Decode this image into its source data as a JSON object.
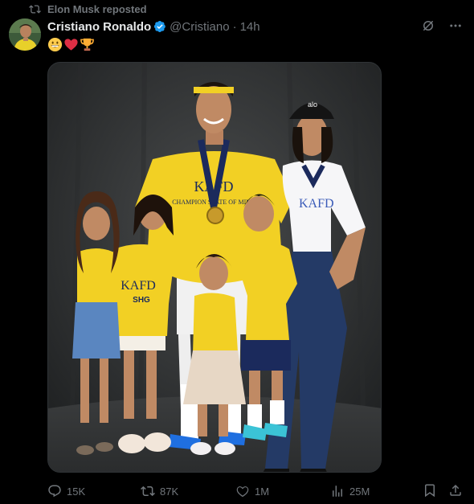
{
  "repost": {
    "label": "Elon Musk reposted",
    "icon": "repost-icon"
  },
  "author": {
    "display_name": "Cristiano Ronaldo",
    "handle": "@Cristiano",
    "separator": "·",
    "time": "14h",
    "verified_color": "#1d9bf0"
  },
  "tweet": {
    "emojis": [
      "grinning-face-emoji",
      "red-heart-emoji",
      "trophy-emoji"
    ]
  },
  "media": {
    "jersey_text": "KAFD",
    "sponsor_text": "SHG",
    "shirt_slogan": "CHAMPION STATE OF MIND",
    "cap_text": "alo"
  },
  "actions": {
    "replies": "15K",
    "reposts": "87K",
    "likes": "1M",
    "views": "25M"
  },
  "colors": {
    "background": "#000000",
    "text": "#e7e9ea",
    "muted": "#71767b",
    "accent": "#1d9bf0",
    "jersey_yellow": "#f2d024",
    "jersey_navy": "#1b2a5c"
  }
}
